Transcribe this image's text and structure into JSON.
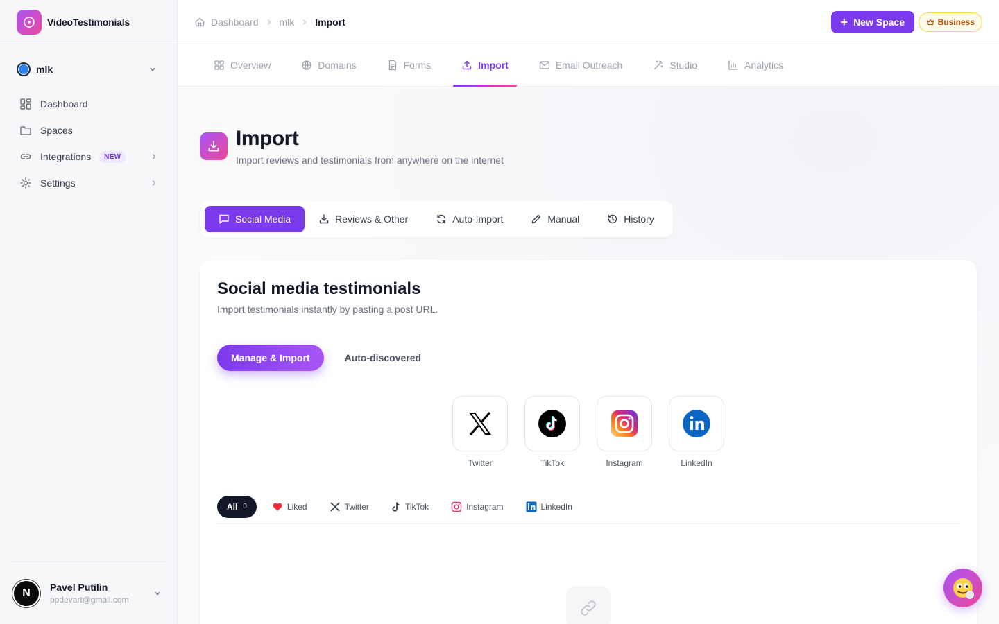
{
  "app": {
    "name": "VideoTestimonials"
  },
  "sidebar": {
    "space": {
      "name": "mlk",
      "color": "#2f80ed"
    },
    "nav": [
      {
        "label": "Dashboard",
        "icon": "grid-icon"
      },
      {
        "label": "Spaces",
        "icon": "folder-icon"
      },
      {
        "label": "Integrations",
        "icon": "link-icon",
        "badge": "NEW"
      },
      {
        "label": "Settings",
        "icon": "gear-icon"
      }
    ],
    "user": {
      "initial": "N",
      "name": "Pavel Putilin",
      "email": "ppdevart@gmail.com"
    }
  },
  "breadcrumb": {
    "items": [
      "Dashboard",
      "mlk"
    ],
    "current": "Import"
  },
  "header": {
    "new_space_label": "New Space",
    "plan_badge": "Business"
  },
  "tabs": [
    {
      "label": "Overview",
      "icon": "grid-icon"
    },
    {
      "label": "Domains",
      "icon": "globe-icon"
    },
    {
      "label": "Forms",
      "icon": "document-icon"
    },
    {
      "label": "Import",
      "icon": "upload-icon",
      "active": true
    },
    {
      "label": "Email Outreach",
      "icon": "mail-icon"
    },
    {
      "label": "Studio",
      "icon": "wand-icon"
    },
    {
      "label": "Analytics",
      "icon": "bar-chart-icon"
    }
  ],
  "page": {
    "title": "Import",
    "subtitle": "Import reviews and testimonials from anywhere on the internet"
  },
  "subtabs": [
    {
      "label": "Social Media",
      "active": true
    },
    {
      "label": "Reviews & Other"
    },
    {
      "label": "Auto-Import"
    },
    {
      "label": "Manual"
    },
    {
      "label": "History"
    }
  ],
  "card": {
    "title": "Social media testimonials",
    "subtitle": "Import testimonials instantly by pasting a post URL.",
    "pills": [
      "Manage & Import",
      "Auto-discovered"
    ],
    "platforms": [
      "Twitter",
      "TikTok",
      "Instagram",
      "LinkedIn"
    ],
    "filters": [
      {
        "label": "All",
        "count": "0",
        "active": true
      },
      {
        "label": "Liked"
      },
      {
        "label": "Twitter"
      },
      {
        "label": "TikTok"
      },
      {
        "label": "Instagram"
      },
      {
        "label": "LinkedIn"
      }
    ]
  },
  "colors": {
    "accent": "#7c3aed",
    "pink": "#ec4899",
    "badge": "#b45309"
  }
}
